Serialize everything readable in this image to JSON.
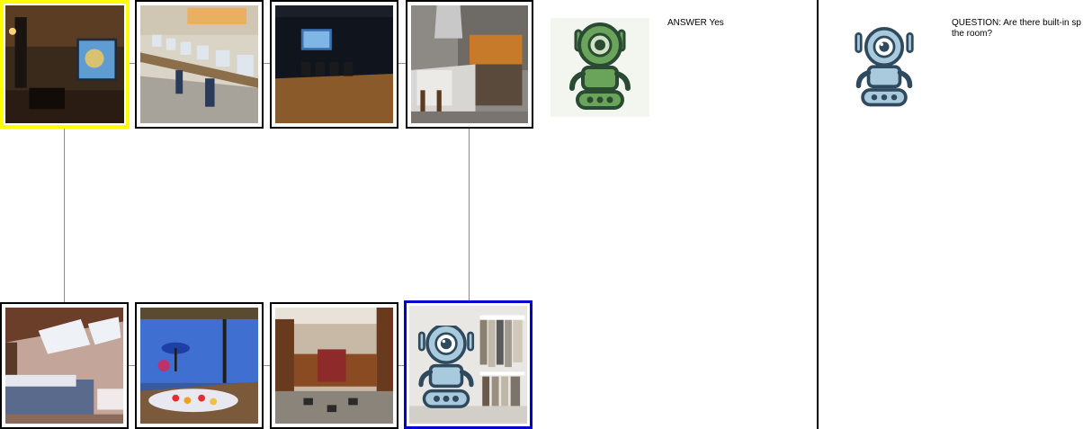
{
  "answer": {
    "text": "ANSWER Yes"
  },
  "question": {
    "text": "QUESTION: Are there built-in sp the room?"
  },
  "tiles_top": [
    {
      "scene": "home theater room",
      "selected": "yellow"
    },
    {
      "scene": "computer lab"
    },
    {
      "scene": "dark screening room"
    },
    {
      "scene": "modern kitchen"
    }
  ],
  "tiles_bottom": [
    {
      "scene": "attic bedroom"
    },
    {
      "scene": "bathroom with flower bath"
    },
    {
      "scene": "basement bar"
    },
    {
      "scene": "walk-in closet",
      "selected": "blue"
    }
  ],
  "icons": {
    "green_robot": "green-robot-icon",
    "blue_robot": "blue-robot-icon"
  },
  "colors": {
    "selection_yellow": "#ffff00",
    "selection_blue": "#0000cc",
    "robot_green": "#6aa35a",
    "robot_blue": "#a9c9dd"
  }
}
